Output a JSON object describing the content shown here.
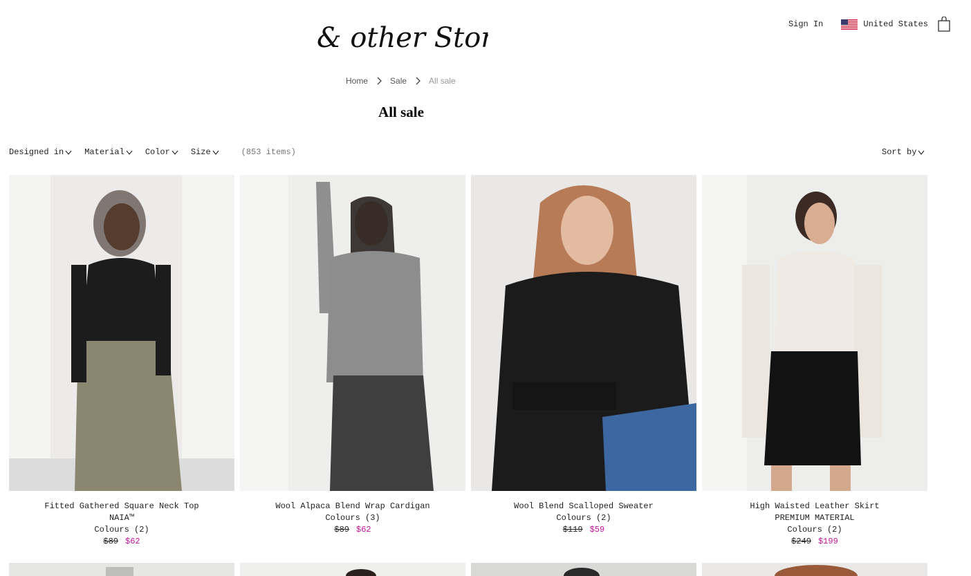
{
  "brand": {
    "logo_text": "& other Stories"
  },
  "header": {
    "sign_in": "Sign In",
    "country": "United States",
    "bag_icon": "shopping-bag-icon"
  },
  "breadcrumb": {
    "items": [
      "Home",
      "Sale",
      "All sale"
    ]
  },
  "page": {
    "title": "All sale"
  },
  "filters": {
    "items": [
      "Designed in",
      "Material",
      "Color",
      "Size"
    ],
    "item_count": "(853 items)",
    "sort_label": "Sort by"
  },
  "products": [
    {
      "name": "Fitted Gathered Square Neck Top",
      "tag": "NAIA™",
      "colours": "Colours (2)",
      "old_price": "$89",
      "new_price": "$62"
    },
    {
      "name": "Wool Alpaca Blend Wrap Cardigan",
      "tag": "",
      "colours": "Colours (3)",
      "old_price": "$89",
      "new_price": "$62"
    },
    {
      "name": "Wool Blend Scalloped Sweater",
      "tag": "",
      "colours": "Colours (2)",
      "old_price": "$119",
      "new_price": "$59"
    },
    {
      "name": "High Waisted Leather Skirt",
      "tag": "PREMIUM MATERIAL",
      "colours": "Colours (2)",
      "old_price": "$249",
      "new_price": "$199"
    }
  ],
  "colors": {
    "sale_price": "#c0149b",
    "text": "#222222"
  }
}
